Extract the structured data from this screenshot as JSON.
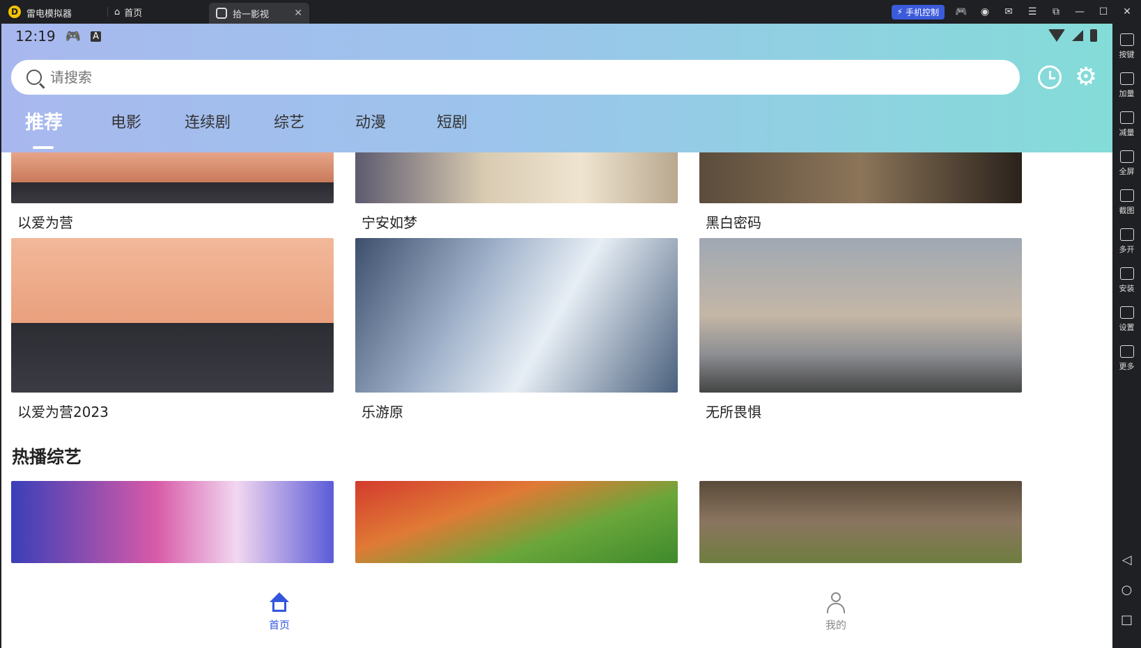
{
  "titlebar": {
    "app_name": "雷电模拟器",
    "home_tab": "首页",
    "active_tab": "拾一影视",
    "phone_control": "手机控制"
  },
  "sidebar": {
    "items": [
      "按键",
      "加量",
      "减量",
      "全屏",
      "截图",
      "多开",
      "安装",
      "设置",
      "更多"
    ]
  },
  "status": {
    "time": "12:19"
  },
  "search": {
    "placeholder": "请搜索"
  },
  "tabs": [
    "推荐",
    "电影",
    "连续剧",
    "综艺",
    "动漫",
    "短剧"
  ],
  "rows": [
    {
      "cards": [
        "以爱为营",
        "宁安如梦",
        "黑白密码"
      ]
    },
    {
      "cards": [
        "以爱为营2023",
        "乐游原",
        "无所畏惧"
      ]
    }
  ],
  "section_variety": {
    "title": "热播综艺"
  },
  "bottom_nav": {
    "home": "首页",
    "me": "我的"
  },
  "colors": {
    "accent": "#3355dd",
    "header_start": "#a8b8ee",
    "header_end": "#84dcd8"
  }
}
